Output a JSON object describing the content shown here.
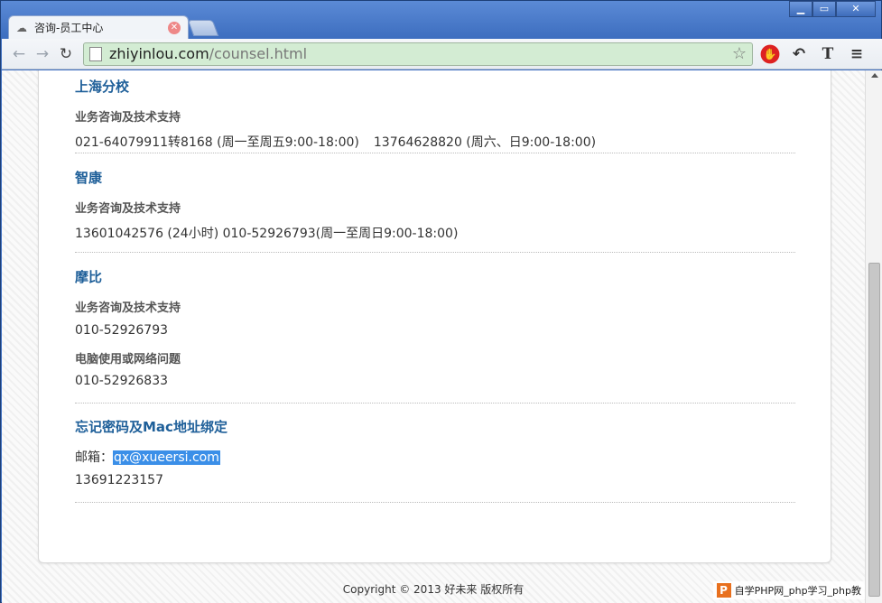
{
  "browser": {
    "tab_title": "咨询-员工中心",
    "url_host": "zhiyinlou.com",
    "url_path": "/counsel.html",
    "win_minimize": "▁",
    "win_maximize": "▭",
    "win_close": "✕",
    "tab_close": "✕"
  },
  "sections": [
    {
      "title": "上海分校",
      "sub1": "业务咨询及技术支持",
      "line1a": "021-64079911转8168 (周一至周五9:00-18:00)",
      "line1b": "13764628820 (周六、日9:00-18:00)"
    },
    {
      "title": "智康",
      "sub1": "业务咨询及技术支持",
      "line1": "13601042576 (24小时) 010-52926793(周一至周日9:00-18:00)"
    },
    {
      "title": "摩比",
      "sub1": "业务咨询及技术支持",
      "line1": "010-52926793",
      "sub2": "电脑使用或网络问题",
      "line2": "010-52926833"
    },
    {
      "title": "忘记密码及Mac地址绑定",
      "email_label": "邮箱：",
      "email": "qx@xueersi.com",
      "phone": "13691223157"
    }
  ],
  "footer": "Copyright © 2013 好未来 版权所有",
  "watermark": "自学PHP网_php学习_php教",
  "watermark_logo": "P"
}
